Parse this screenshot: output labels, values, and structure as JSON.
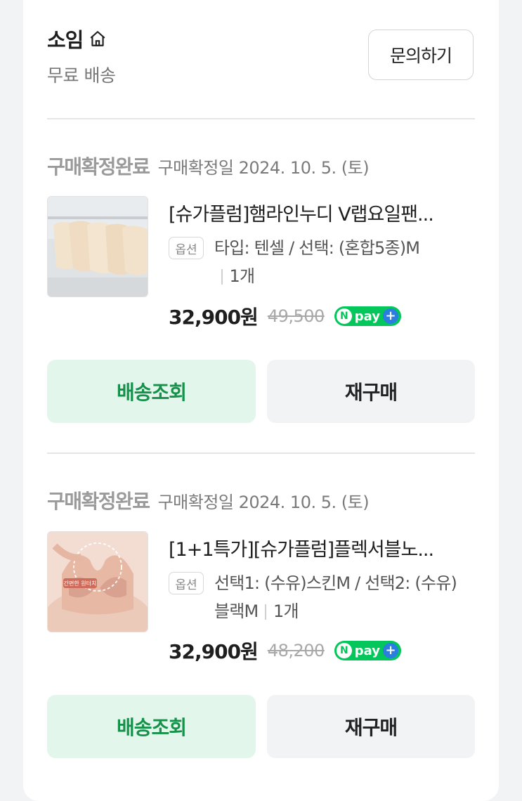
{
  "store": {
    "name": "소임",
    "shipping": "무료 배송",
    "inquire_label": "문의하기"
  },
  "orders": [
    {
      "status": "구매확정완료",
      "date": "구매확정일 2024. 10. 5. (토)",
      "title": "[슈가플럼]햄라인누디 V랩요일팬...",
      "option_badge": "옵션",
      "option_text": "타입: 텐셀 / 선택: (혼합5종)M",
      "quantity": "1개",
      "price": "32,900원",
      "original_price": "49,500",
      "npay_label": "pay",
      "track_label": "배송조회",
      "rebuy_label": "재구매"
    },
    {
      "status": "구매확정완료",
      "date": "구매확정일 2024. 10. 5. (토)",
      "title": "[1+1특가][슈가플럼]플렉서블노...",
      "option_badge": "옵션",
      "option_text": "선택1: (수유)스킨M / 선택2: (수유)블랙M",
      "quantity": "1개",
      "price": "32,900원",
      "original_price": "48,200",
      "npay_label": "pay",
      "track_label": "배송조회",
      "rebuy_label": "재구매",
      "thumb_caption": "간편한 원터치"
    }
  ],
  "colors": {
    "track_bg": "#e3f6ec",
    "track_text": "#14924a",
    "npay": "#03c75a"
  }
}
